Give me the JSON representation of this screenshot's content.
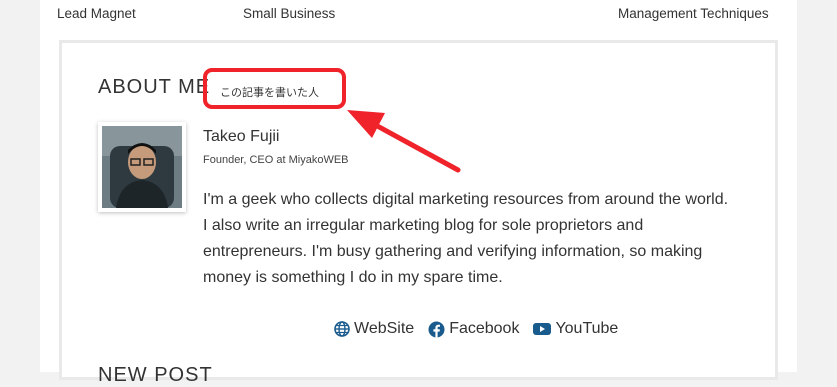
{
  "related": {
    "labels": [
      "Lead Magnet",
      "Small Business",
      "Management Techniques"
    ]
  },
  "about": {
    "heading": "ABOUT ME",
    "subheading": "この記事を書いた人",
    "annotation_color": "#f0232b"
  },
  "author": {
    "name": "Takeo Fujii",
    "role": "Founder, CEO at MiyakoWEB",
    "bio_lines": [
      "I'm a geek who collects digital marketing resources from around the world.",
      "I also write an irregular marketing blog for sole proprietors and",
      "entrepreneurs. I'm busy gathering and verifying information, so making",
      "money is something I do in my spare time."
    ]
  },
  "social": [
    {
      "label": "WebSite",
      "icon": "globe-icon",
      "color": "#1a5b8e"
    },
    {
      "label": "Facebook",
      "icon": "facebook-icon",
      "color": "#1a5b8e"
    },
    {
      "label": "YouTube",
      "icon": "youtube-icon",
      "color": "#1a5b8e"
    }
  ],
  "next_section": {
    "heading": "NEW POST"
  }
}
